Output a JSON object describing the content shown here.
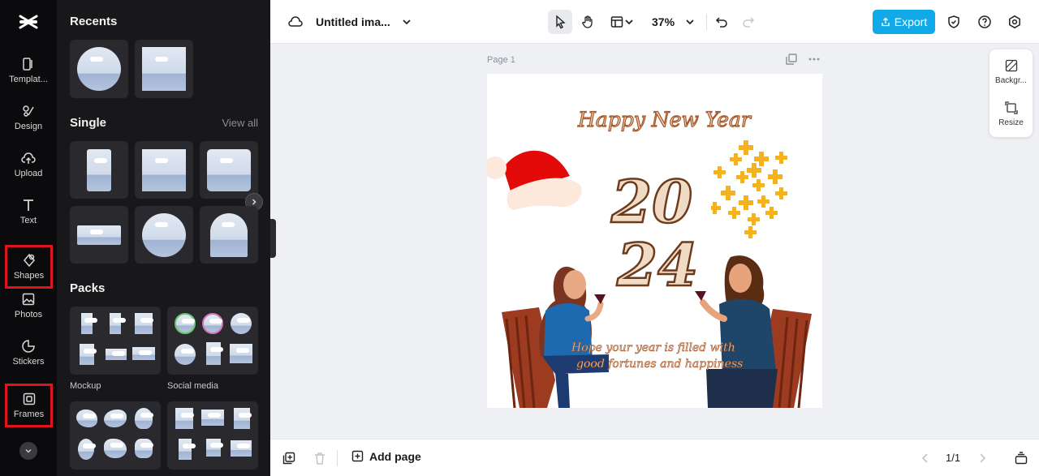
{
  "rail": {
    "items": [
      {
        "label": "Templat..."
      },
      {
        "label": "Design"
      },
      {
        "label": "Upload"
      },
      {
        "label": "Text"
      },
      {
        "label": "Shapes"
      },
      {
        "label": "Photos"
      },
      {
        "label": "Stickers"
      },
      {
        "label": "Frames"
      }
    ]
  },
  "panel": {
    "recents_title": "Recents",
    "single_title": "Single",
    "view_all": "View all",
    "packs_title": "Packs",
    "pack_labels": [
      "Mockup",
      "Social media"
    ]
  },
  "topbar": {
    "doc_title": "Untitled ima...",
    "zoom": "37%",
    "export_label": "Export"
  },
  "canvas": {
    "page_label": "Page 1",
    "heading": "Happy New Year",
    "year_top": "20",
    "year_bottom": "24",
    "message_line1": "Hope your year is filled with",
    "message_line2": "good fortunes and happiness"
  },
  "side_tools": {
    "background_label": "Backgr...",
    "resize_label": "Resize"
  },
  "bottombar": {
    "add_page_label": "Add page",
    "page_count": "1/1"
  },
  "colors": {
    "accent": "#12a9e9",
    "highlight": "#e0141c"
  }
}
